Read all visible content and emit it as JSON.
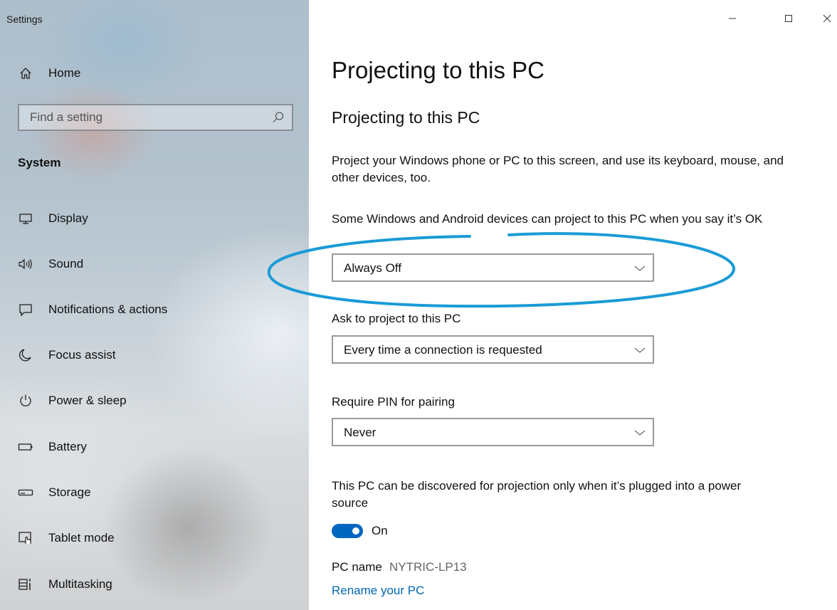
{
  "window": {
    "app_title": "Settings",
    "controls": {
      "minimize": "minimize-icon",
      "maximize": "maximize-icon",
      "close": "close-icon"
    }
  },
  "sidebar": {
    "home_label": "Home",
    "search": {
      "placeholder": "Find a setting",
      "value": ""
    },
    "section_label": "System",
    "items": [
      {
        "label": "Display",
        "icon": "display-icon"
      },
      {
        "label": "Sound",
        "icon": "sound-icon"
      },
      {
        "label": "Notifications & actions",
        "icon": "notifications-icon"
      },
      {
        "label": "Focus assist",
        "icon": "focus-assist-icon"
      },
      {
        "label": "Power & sleep",
        "icon": "power-icon"
      },
      {
        "label": "Battery",
        "icon": "battery-icon"
      },
      {
        "label": "Storage",
        "icon": "storage-icon"
      },
      {
        "label": "Tablet mode",
        "icon": "tablet-mode-icon"
      },
      {
        "label": "Multitasking",
        "icon": "multitasking-icon"
      }
    ]
  },
  "main": {
    "page_title": "Projecting to this PC",
    "section_title": "Projecting to this PC",
    "description": "Project your Windows phone or PC to this screen, and use its keyboard, mouse, and other devices, too.",
    "project_setting": {
      "label": "Some Windows and Android devices can project to this PC when you say it’s OK",
      "selected": "Always Off"
    },
    "ask_setting": {
      "label": "Ask to project to this PC",
      "selected": "Every time a connection is requested"
    },
    "pin_setting": {
      "label": "Require PIN for pairing",
      "selected": "Never"
    },
    "power_note": "This PC can be discovered for projection only when it’s plugged into a power source",
    "toggle": {
      "state": "On",
      "on": true
    },
    "pc_name": {
      "label": "PC name",
      "value": "NYTRIC-LP13"
    },
    "rename_link": "Rename your PC"
  },
  "colors": {
    "accent": "#0067c0",
    "link": "#0066b4",
    "annotation": "#1a9bd7"
  }
}
